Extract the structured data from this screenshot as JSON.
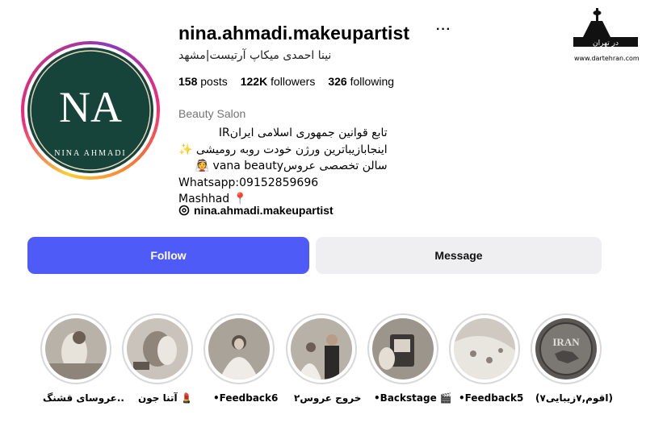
{
  "watermark": {
    "site": "www.dartehran.com",
    "logo_text": "در تهران"
  },
  "profile": {
    "username": "nina.ahmadi.makeupartist",
    "more_label": "···",
    "full_name": "نینا احمدی میکاپ آرتیست|مشهد",
    "avatar_text_top": "NA",
    "avatar_text_ring": "NINA AHMADI"
  },
  "stats": {
    "posts_count": "158",
    "posts_label": "posts",
    "followers_count": "122K",
    "followers_label": "followers",
    "following_count": "326",
    "following_label": "following"
  },
  "bio": {
    "category": "Beauty Salon",
    "lines": [
      "تابع قوانین جمهوری اسلامی ایرانIR",
      "اینجابازیباترین ورژن خودت روبه رومیشی ✨",
      "سالن تخصصی عروسvana beauty 👰",
      "Whatsapp:09152859696",
      "Mashhad 📍"
    ],
    "threads_handle": "nina.ahmadi.makeupartist"
  },
  "actions": {
    "follow": "Follow",
    "message": "Message"
  },
  "highlights": [
    {
      "label": "عروسای قشنگ..",
      "icon": "bride-photo"
    },
    {
      "label": "آتنا جون 💄",
      "icon": "makeup-photo"
    },
    {
      "label": "•Feedback6",
      "icon": "bride-photo"
    },
    {
      "label": "خروج عروس۲",
      "icon": "couple-photo"
    },
    {
      "label": "•Backstage 🎬",
      "icon": "camera-photo"
    },
    {
      "label": "•Feedback5",
      "icon": "lace-photo"
    },
    {
      "label": "(۷اقوم,۷زیبایی)",
      "icon": "iran-coin-photo",
      "overlay": "IRAN"
    }
  ],
  "colors": {
    "follow": "#4f5bf7",
    "message": "#efeff1",
    "avatar_bg": "#17443a"
  }
}
